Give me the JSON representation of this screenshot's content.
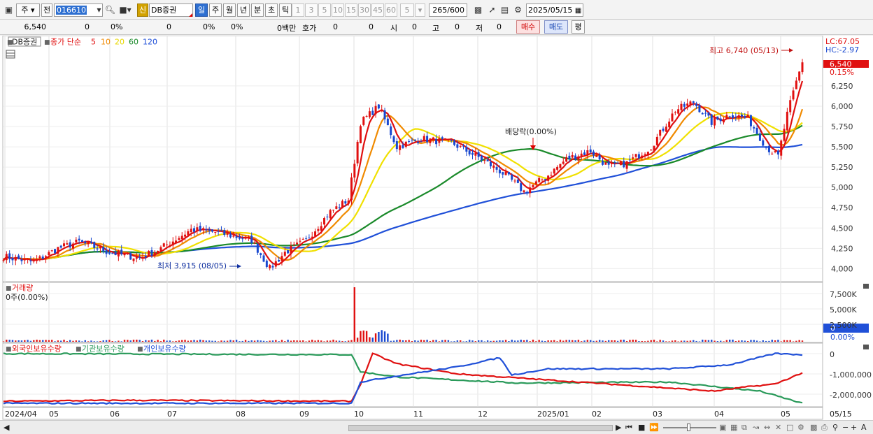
{
  "toolbar": {
    "period_type": "주",
    "prev_label": "전",
    "code": "016610",
    "stock_new_badge": "신",
    "stock_name": "DB증권",
    "periods": [
      "일",
      "주",
      "월",
      "년",
      "분",
      "초",
      "틱"
    ],
    "active_period": "일",
    "minutes": [
      "1",
      "3",
      "5",
      "10",
      "15",
      "30",
      "45",
      "60"
    ],
    "custom_minute": "5",
    "count": "265",
    "count_total": "/600",
    "date": "2025/05/15"
  },
  "infobar": {
    "price": "6,540",
    "change": "0",
    "change_pct": "0%",
    "volume": "0",
    "vol_pct1": "0%",
    "vol_pct2": "0%",
    "amount": "0백만",
    "quote_label": "호가",
    "quote1": "0",
    "quote2": "0",
    "open_label": "시",
    "open": "0",
    "high_label": "고",
    "high": "0",
    "low_label": "저",
    "low": "0",
    "buy_label": "매수",
    "sell_label": "매도",
    "eval_label": "평"
  },
  "price_panel": {
    "stock_tag": "DB증권",
    "legend_prefix": "종가 단순",
    "ma_legend": [
      {
        "period": "5",
        "color": "#e01010"
      },
      {
        "period": "10",
        "color": "#f08a00"
      },
      {
        "period": "20",
        "color": "#e8d800"
      },
      {
        "period": "60",
        "color": "#1a8a2a"
      },
      {
        "period": "120",
        "color": "#2050d8"
      }
    ],
    "lc_label": "LC:67.05",
    "hc_label": "HC:-2.97",
    "current_price_tag": "6,540",
    "current_change_tag": "0.15%",
    "high_annotation": "최고 6,740 (05/13)",
    "low_annotation": "최저 3,915 (08/05)",
    "dividend_annotation": "배당락(0.00%)",
    "y_ticks": [
      "6,250",
      "6,000",
      "5,750",
      "5,500",
      "5,250",
      "5,000",
      "4,750",
      "4,500",
      "4,250",
      "4,000"
    ]
  },
  "volume_panel": {
    "title": "거래량",
    "value": "0주(0.00%)",
    "y_ticks": [
      "7,500K",
      "5,000K",
      "2,500K"
    ],
    "current_tag": "0",
    "current_pct": "0.00%"
  },
  "holding_panel": {
    "legend": [
      "외국인보유수량",
      "기관보유수량",
      "개인보유수량"
    ],
    "y_ticks": [
      "0",
      "-1,000,000",
      "-2,000,000"
    ]
  },
  "x_axis": [
    "2024/04",
    "05",
    "06",
    "07",
    "08",
    "09",
    "10",
    "11",
    "12",
    "2025/01",
    "02",
    "03",
    "04",
    "05",
    "05/15"
  ],
  "colors": {
    "up": "#e01010",
    "down": "#1848d0",
    "ma5": "#e01010",
    "ma10": "#f08a00",
    "ma20": "#f0e000",
    "ma60": "#1a8a2a",
    "ma120": "#2050d8",
    "foreign": "#e01010",
    "institution": "#2a9a5a",
    "individual": "#2050d8"
  },
  "chart_data": {
    "type": "candlestick",
    "period": "daily",
    "x_range": [
      "2024/04",
      "2025/05/15"
    ],
    "ylim": [
      3900,
      6800
    ],
    "price_path_monthly": [
      {
        "month": "2024/04",
        "close": 4150
      },
      {
        "month": "2024/05",
        "close": 4300
      },
      {
        "month": "2024/06",
        "close": 4100
      },
      {
        "month": "2024/07",
        "close": 4500
      },
      {
        "month": "2024/08",
        "close": 4300
      },
      {
        "month": "2024/09",
        "close": 5950
      },
      {
        "month": "2024/10",
        "close": 5600
      },
      {
        "month": "2024/11",
        "close": 5000
      },
      {
        "month": "2024/12",
        "close": 5350
      },
      {
        "month": "2025/01",
        "close": 5300
      },
      {
        "month": "2025/02",
        "close": 6050
      },
      {
        "month": "2025/03",
        "close": 5850
      },
      {
        "month": "2025/04",
        "close": 5400
      },
      {
        "month": "2025/05",
        "close": 6540
      }
    ],
    "highest": {
      "value": 6740,
      "date": "05/13"
    },
    "lowest": {
      "value": 3915,
      "date": "08/05"
    },
    "last_close": 6540,
    "moving_averages": [
      "5",
      "10",
      "20",
      "60",
      "120"
    ],
    "volume_peak_month": "2024/09",
    "volume_ylim": [
      0,
      8000000
    ],
    "holding_series": [
      {
        "name": "외국인보유수량"
      },
      {
        "name": "기관보유수량"
      },
      {
        "name": "개인보유수량"
      }
    ]
  }
}
